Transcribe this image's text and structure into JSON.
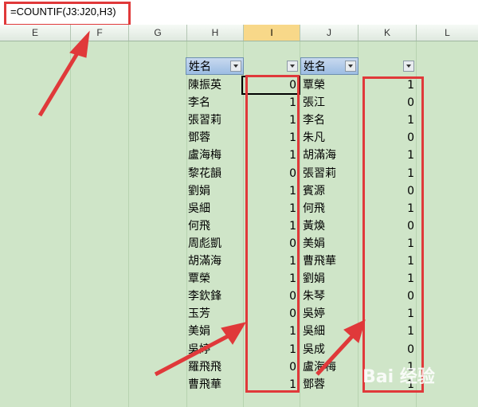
{
  "formula": "=COUNTIF(J3:J20,H3)",
  "columns": [
    "E",
    "F",
    "G",
    "H",
    "I",
    "J",
    "K",
    "L"
  ],
  "header_h": "姓名",
  "header_j": "姓名",
  "col_h": [
    "陳振英",
    "李名",
    "張習莉",
    "鄧蓉",
    "盧海梅",
    "黎花韻",
    "劉娟",
    "吳細",
    "何飛",
    "周彪凱",
    "胡滿海",
    "覃榮",
    "李欽鋒",
    "玉芳",
    "美娟",
    "吳婷",
    "羅飛飛",
    "曹飛華"
  ],
  "col_i": [
    "0",
    "1",
    "1",
    "1",
    "1",
    "0",
    "1",
    "1",
    "1",
    "0",
    "1",
    "1",
    "0",
    "0",
    "1",
    "1",
    "0",
    "1"
  ],
  "col_j": [
    "覃榮",
    "張江",
    "李名",
    "朱凡",
    "胡滿海",
    "張習莉",
    "賓源",
    "何飛",
    "黃煥",
    "美娟",
    "曹飛華",
    "劉娟",
    "朱琴",
    "吳婷",
    "吳細",
    "吳成",
    "盧海梅",
    "鄧蓉"
  ],
  "col_k": [
    "1",
    "0",
    "1",
    "0",
    "1",
    "1",
    "0",
    "1",
    "0",
    "1",
    "1",
    "1",
    "0",
    "1",
    "1",
    "0",
    "1",
    "1"
  ],
  "watermark": "Bai 经验",
  "accent_red": "#e0393a"
}
